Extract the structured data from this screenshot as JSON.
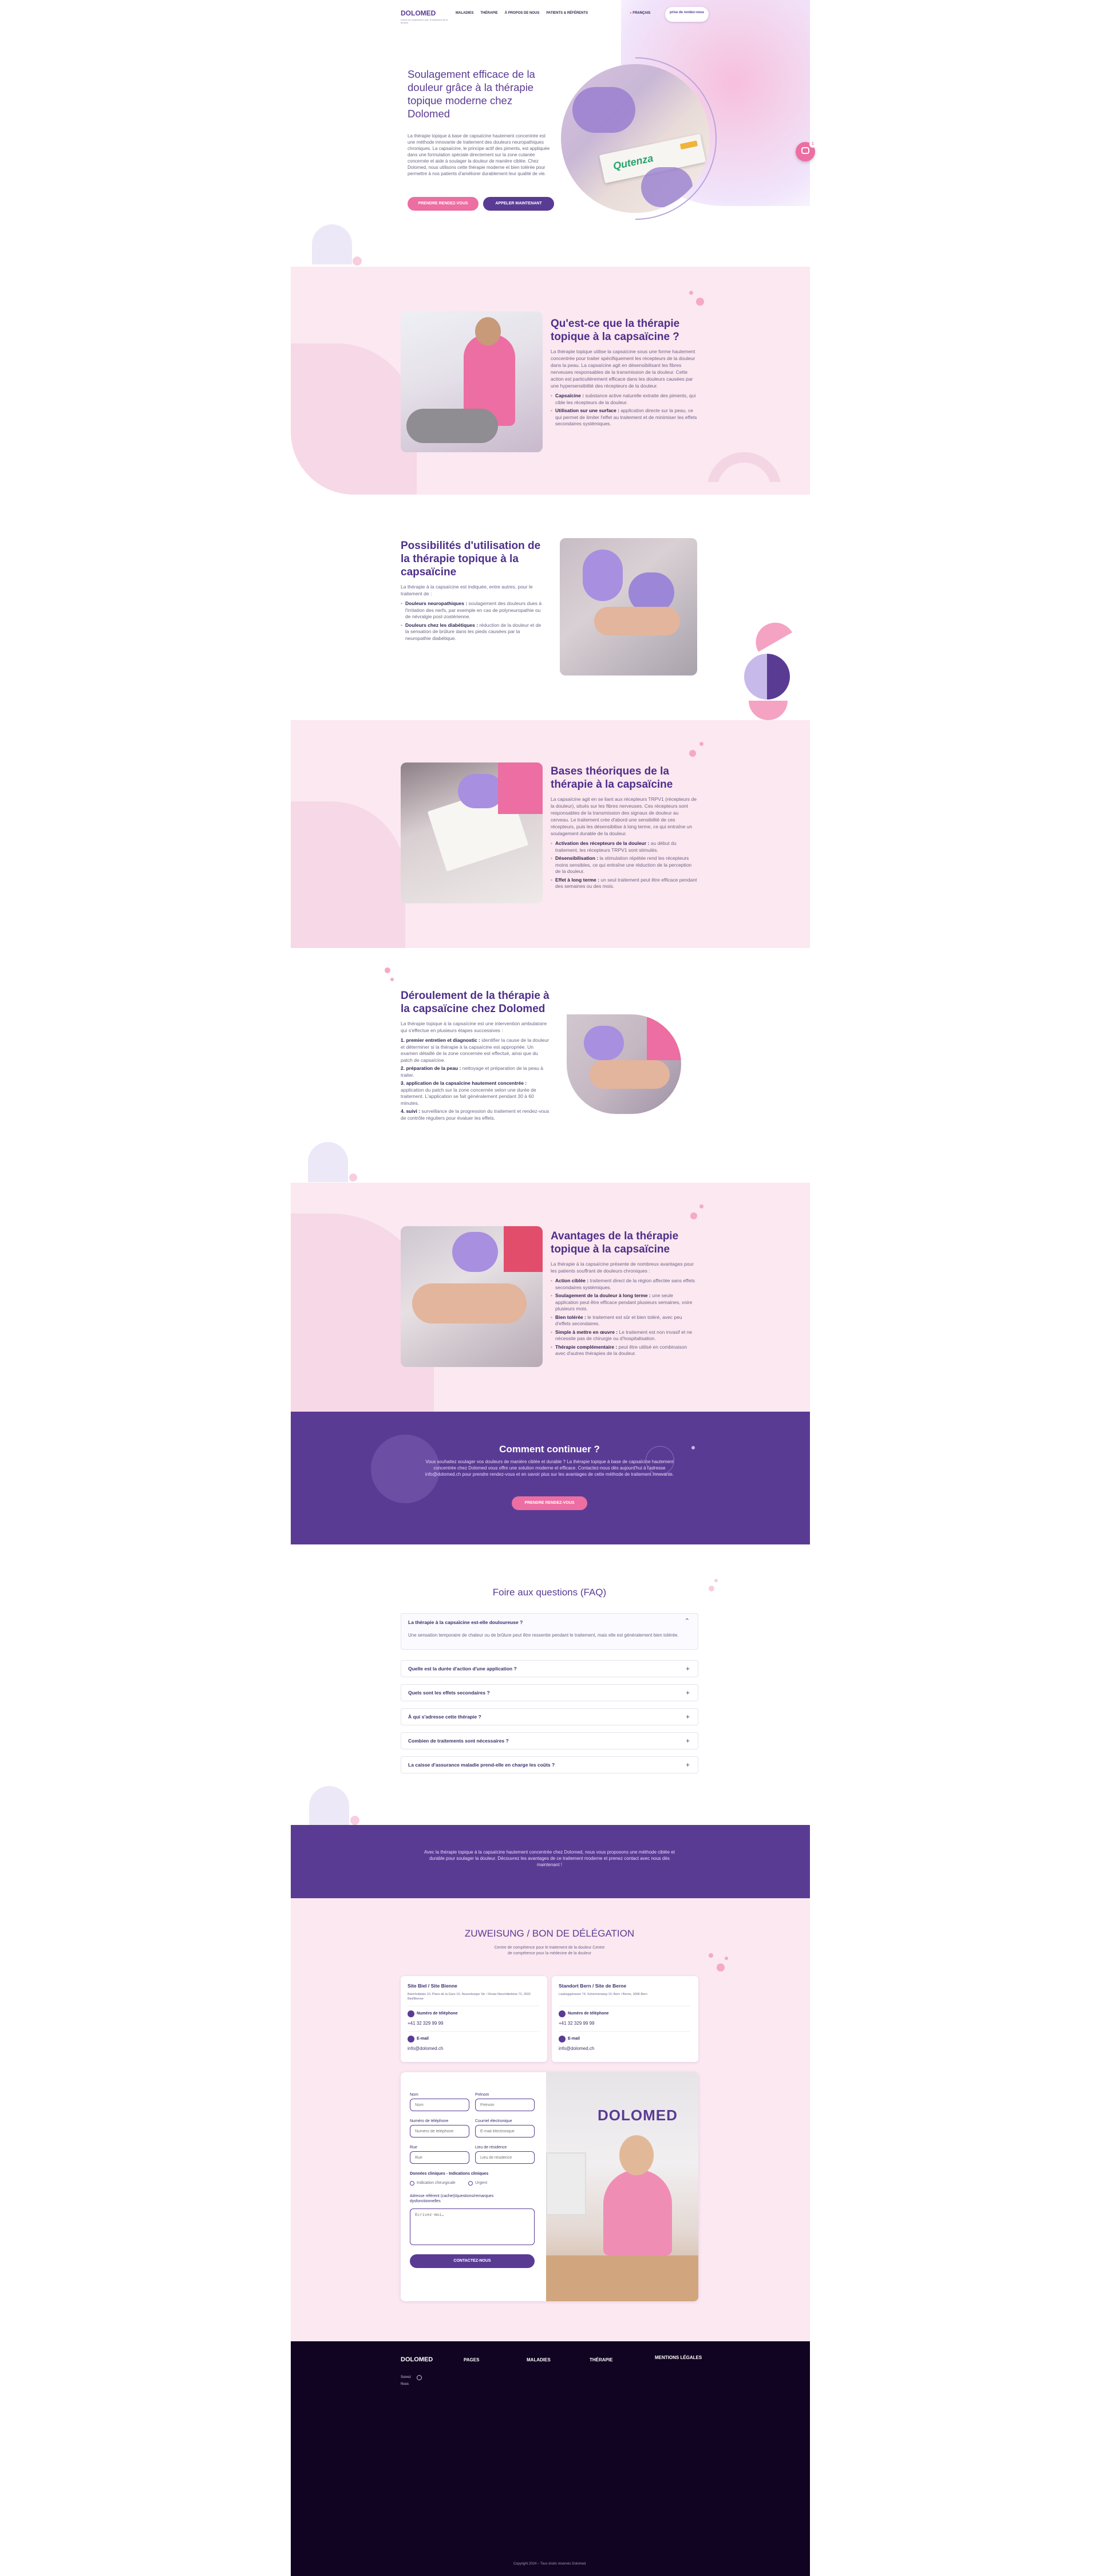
{
  "header": {
    "logo": "DOLOMED",
    "logo_tagline": "Centre de compétence pour le traitement de la douleur",
    "nav": [
      "MALADIES",
      "THÉRAPIE",
      "À PROPOS DE NOUS",
      "PATIENTS & RÉFÉRENTS"
    ],
    "language": "FRANÇAIS",
    "cta": "prise de rendez-vous"
  },
  "hero": {
    "title": "Soulagement efficace de la douleur grâce à la thérapie topique moderne chez Dolomed",
    "text": "La thérapie topique à base de capsaïcine hautement concentrée est une méthode innovante de traitement des douleurs neuropathiques chroniques. La capsaïcine, le principe actif des piments, est appliquée dans une formulation spéciale directement sur la zone cutanée concernée et aide à soulager la douleur de manière ciblée. Chez Dolomed, nous utilisons cette thérapie moderne et bien tolérée pour permettre à nos patients d'améliorer durablement leur qualité de vie.",
    "btn_primary": "PRENDRE RENDEZ-VOUS",
    "btn_secondary": "APPELER MAINTENANT",
    "product_label": "Qutenza",
    "chat_badge": "1"
  },
  "section1": {
    "title": "Qu'est-ce que la thérapie topique à la capsaïcine ?",
    "text": "La thérapie topique utilise la capsaïcine sous une forme hautement concentrée pour traiter spécifiquement les récepteurs de la douleur dans la peau. La capsaïcine agit en désensibilisant les fibres nerveuses responsables de la transmission de la douleur. Cette action est particulièrement efficace dans les douleurs causées par une hypersensibilité des récepteurs de la douleur.",
    "bullets": [
      {
        "term": "Capsaïcine :",
        "text": "substance active naturelle extraite des piments, qui cible les récepteurs de la douleur."
      },
      {
        "term": "Utilisation sur une surface :",
        "text": "application directe sur la peau, ce qui permet de limiter l'effet au traitement et de minimiser les effets secondaires systémiques."
      }
    ]
  },
  "section2": {
    "title": "Possibilités d'utilisation de la thérapie topique à la capsaïcine",
    "text": "La thérapie à la capsaïcine est indiquée, entre autres, pour le traitement de :",
    "bullets": [
      {
        "term": "Douleurs neuropathiques :",
        "text": "soulagement des douleurs dues à l'irritation des nerfs, par exemple en cas de polyneuropathie ou de névralgie post-zostérienne."
      },
      {
        "term": "Douleurs chez les diabétiques :",
        "text": "réduction de la douleur et de la sensation de brûlure dans les pieds causées par la neuropathie diabétique."
      }
    ]
  },
  "section3": {
    "title": "Bases théoriques de la thérapie à la capsaïcine",
    "text": "La capsaïcine agit en se liant aux récepteurs TRPV1 (récepteurs de la douleur), situés sur les fibres nerveuses. Ces récepteurs sont responsables de la transmission des signaux de douleur au cerveau. Le traitement crée d'abord une sensibilité de ces récepteurs, puis les désensibilise à long terme, ce qui entraîne un soulagement durable de la douleur.",
    "bullets": [
      {
        "term": "Activation des récepteurs de la douleur :",
        "text": "au début du traitement, les récepteurs TRPV1 sont stimulés."
      },
      {
        "term": "Désensibilisation :",
        "text": "la stimulation répétée rend les récepteurs moins sensibles, ce qui entraîne une réduction de la perception de la douleur."
      },
      {
        "term": "Effet à long terme :",
        "text": "un seul traitement peut être efficace pendant des semaines ou des mois."
      }
    ]
  },
  "section4": {
    "title": "Déroulement de la thérapie à la capsaïcine chez Dolomed",
    "text": "La thérapie topique à la capsaïcine est une intervention ambulatoire qui s'effectue en plusieurs étapes successives :",
    "steps": [
      {
        "term": "1. premier entretien et diagnostic :",
        "text": "identifier la cause de la douleur et déterminer si la thérapie à la capsaïcine est appropriée. Un examen détaillé de la zone concernée est effectué, ainsi que du patch de capsaïcine."
      },
      {
        "term": "2. préparation de la peau :",
        "text": "nettoyage et préparation de la peau à traiter."
      },
      {
        "term": "3. application de la capsaïcine hautement concentrée :",
        "text": "application du patch sur la zone concernée selon une durée de traitement. L'application se fait généralement pendant 30 à 60 minutes."
      },
      {
        "term": "4. suivi :",
        "text": "surveillance de la progression du traitement et rendez-vous de contrôle réguliers pour évaluer les effets."
      }
    ]
  },
  "section5": {
    "title": "Avantages de la thérapie topique à la capsaïcine",
    "text": "La thérapie à la capsaïcine présente de nombreux avantages pour les patients souffrant de douleurs chroniques :",
    "bullets": [
      {
        "term": "Action ciblée :",
        "text": "traitement direct de la région affectée sans effets secondaires systémiques."
      },
      {
        "term": "Soulagement de la douleur à long terme :",
        "text": "une seule application peut être efficace pendant plusieurs semaines, voire plusieurs mois."
      },
      {
        "term": "Bien tolérée :",
        "text": "le traitement est sûr et bien toléré, avec peu d'effets secondaires."
      },
      {
        "term": "Simple à mettre en œuvre :",
        "text": "Le traitement est non invasif et ne nécessite pas de chirurgie ou d'hospitalisation."
      },
      {
        "term": "Thérapie complémentaire :",
        "text": "peut être utilisé en combinaison avec d'autres thérapies de la douleur."
      }
    ]
  },
  "continue": {
    "title": "Comment continuer ?",
    "text": "Vous souhaitez soulager vos douleurs de manière ciblée et durable ? La thérapie topique à base de capsaïcine hautement concentrée chez Dolomed vous offre une solution moderne et efficace. Contactez-nous dès aujourd'hui à l'adresse info@dolomed.ch pour prendre rendez-vous et en savoir plus sur les avantages de cette méthode de traitement innovante.",
    "button": "PRENDRE RENDEZ-VOUS"
  },
  "faq": {
    "title": "Foire aux questions (FAQ)",
    "open_question": "La thérapie à la capsaïcine est-elle douloureuse ?",
    "open_answer": "Une sensation temporaire de chaleur ou de brûlure peut être ressentie pendant le traitement, mais elle est généralement bien tolérée.",
    "questions": [
      "Quelle est la durée d'action d'une application ?",
      "Quels sont les effets secondaires ?",
      "À qui s'adresse cette thérapie ?",
      "Combien de traitements sont nécessaires ?",
      "La caisse d'assurance maladie prend-elle en charge les coûts ?"
    ]
  },
  "banner": {
    "text": "Avec la thérapie topique à la capsaïcine hautement concentrée chez Dolomed, nous vous proposons une méthode ciblée et durable pour soulager la douleur. Découvrez les avantages de ce traitement moderne et prenez contact avec nous dès maintenant !"
  },
  "delegation": {
    "title": "ZUWEISUNG / BON DE DÉLÉGATION",
    "subtitle": "Centre de compétence pour le traitement de la douleur Centre de compétence pour la médecine de la douleur",
    "locations": [
      {
        "name": "Site Biel / Site Bienne",
        "address": "Bahnhofplatz 10, Place de la Gare 10, Neuenburger Str. / Route Neuchâteloise 72, 2502 Biel/Bienne",
        "phone_label": "Numéro de téléphone",
        "phone": "+41 32 329 99 99",
        "email_label": "E-mail",
        "email": "info@dolomed.ch"
      },
      {
        "name": "Standort Bern / Site de Berne",
        "address": "Laubeggstrasse 74, Schermenweg 10, Bern / Berne, 3006 Bern",
        "phone_label": "Numéro de téléphone",
        "phone": "+41 32 329 99 99",
        "email_label": "E-mail",
        "email": "info@dolomed.ch"
      }
    ]
  },
  "form": {
    "labels": {
      "name": "Nom",
      "firstname": "Prénom",
      "phone": "Numéro de téléphone",
      "email": "Courriel électronique",
      "street": "Rue",
      "city": "Lieu de résidence",
      "checkbox_title": "Données cliniques - Indications cliniques",
      "check1": "Indication chirurgicale",
      "check2": "Urgent",
      "message": "Adresse référent (cachet)/questions/remarques dysfonctionnelles"
    },
    "placeholders": {
      "name": "Nom",
      "firstname": "Prénom",
      "phone": "Numéro de téléphone",
      "email": "E-mail électronique",
      "street": "Rue",
      "city": "Lieu de résidence",
      "message": "Écrivez-moi…"
    },
    "submit": "CONTACTEZ-NOUS",
    "photo_sign": "DOLOMED"
  },
  "footer": {
    "logo": "DOLOMED",
    "columns": [
      "PAGES",
      "MALADIES",
      "THÉRAPIE",
      "MENTIONS LÉGALES"
    ],
    "links": [
      "Suivez",
      "Nous"
    ],
    "copyright": "Copyright 2024 – Tous droits réservés Dolomed"
  },
  "colors": {
    "primary": "#5a3b94",
    "accent": "#ec6ea2",
    "pink_bg": "#fbe8f0",
    "footer_bg": "#110422"
  }
}
